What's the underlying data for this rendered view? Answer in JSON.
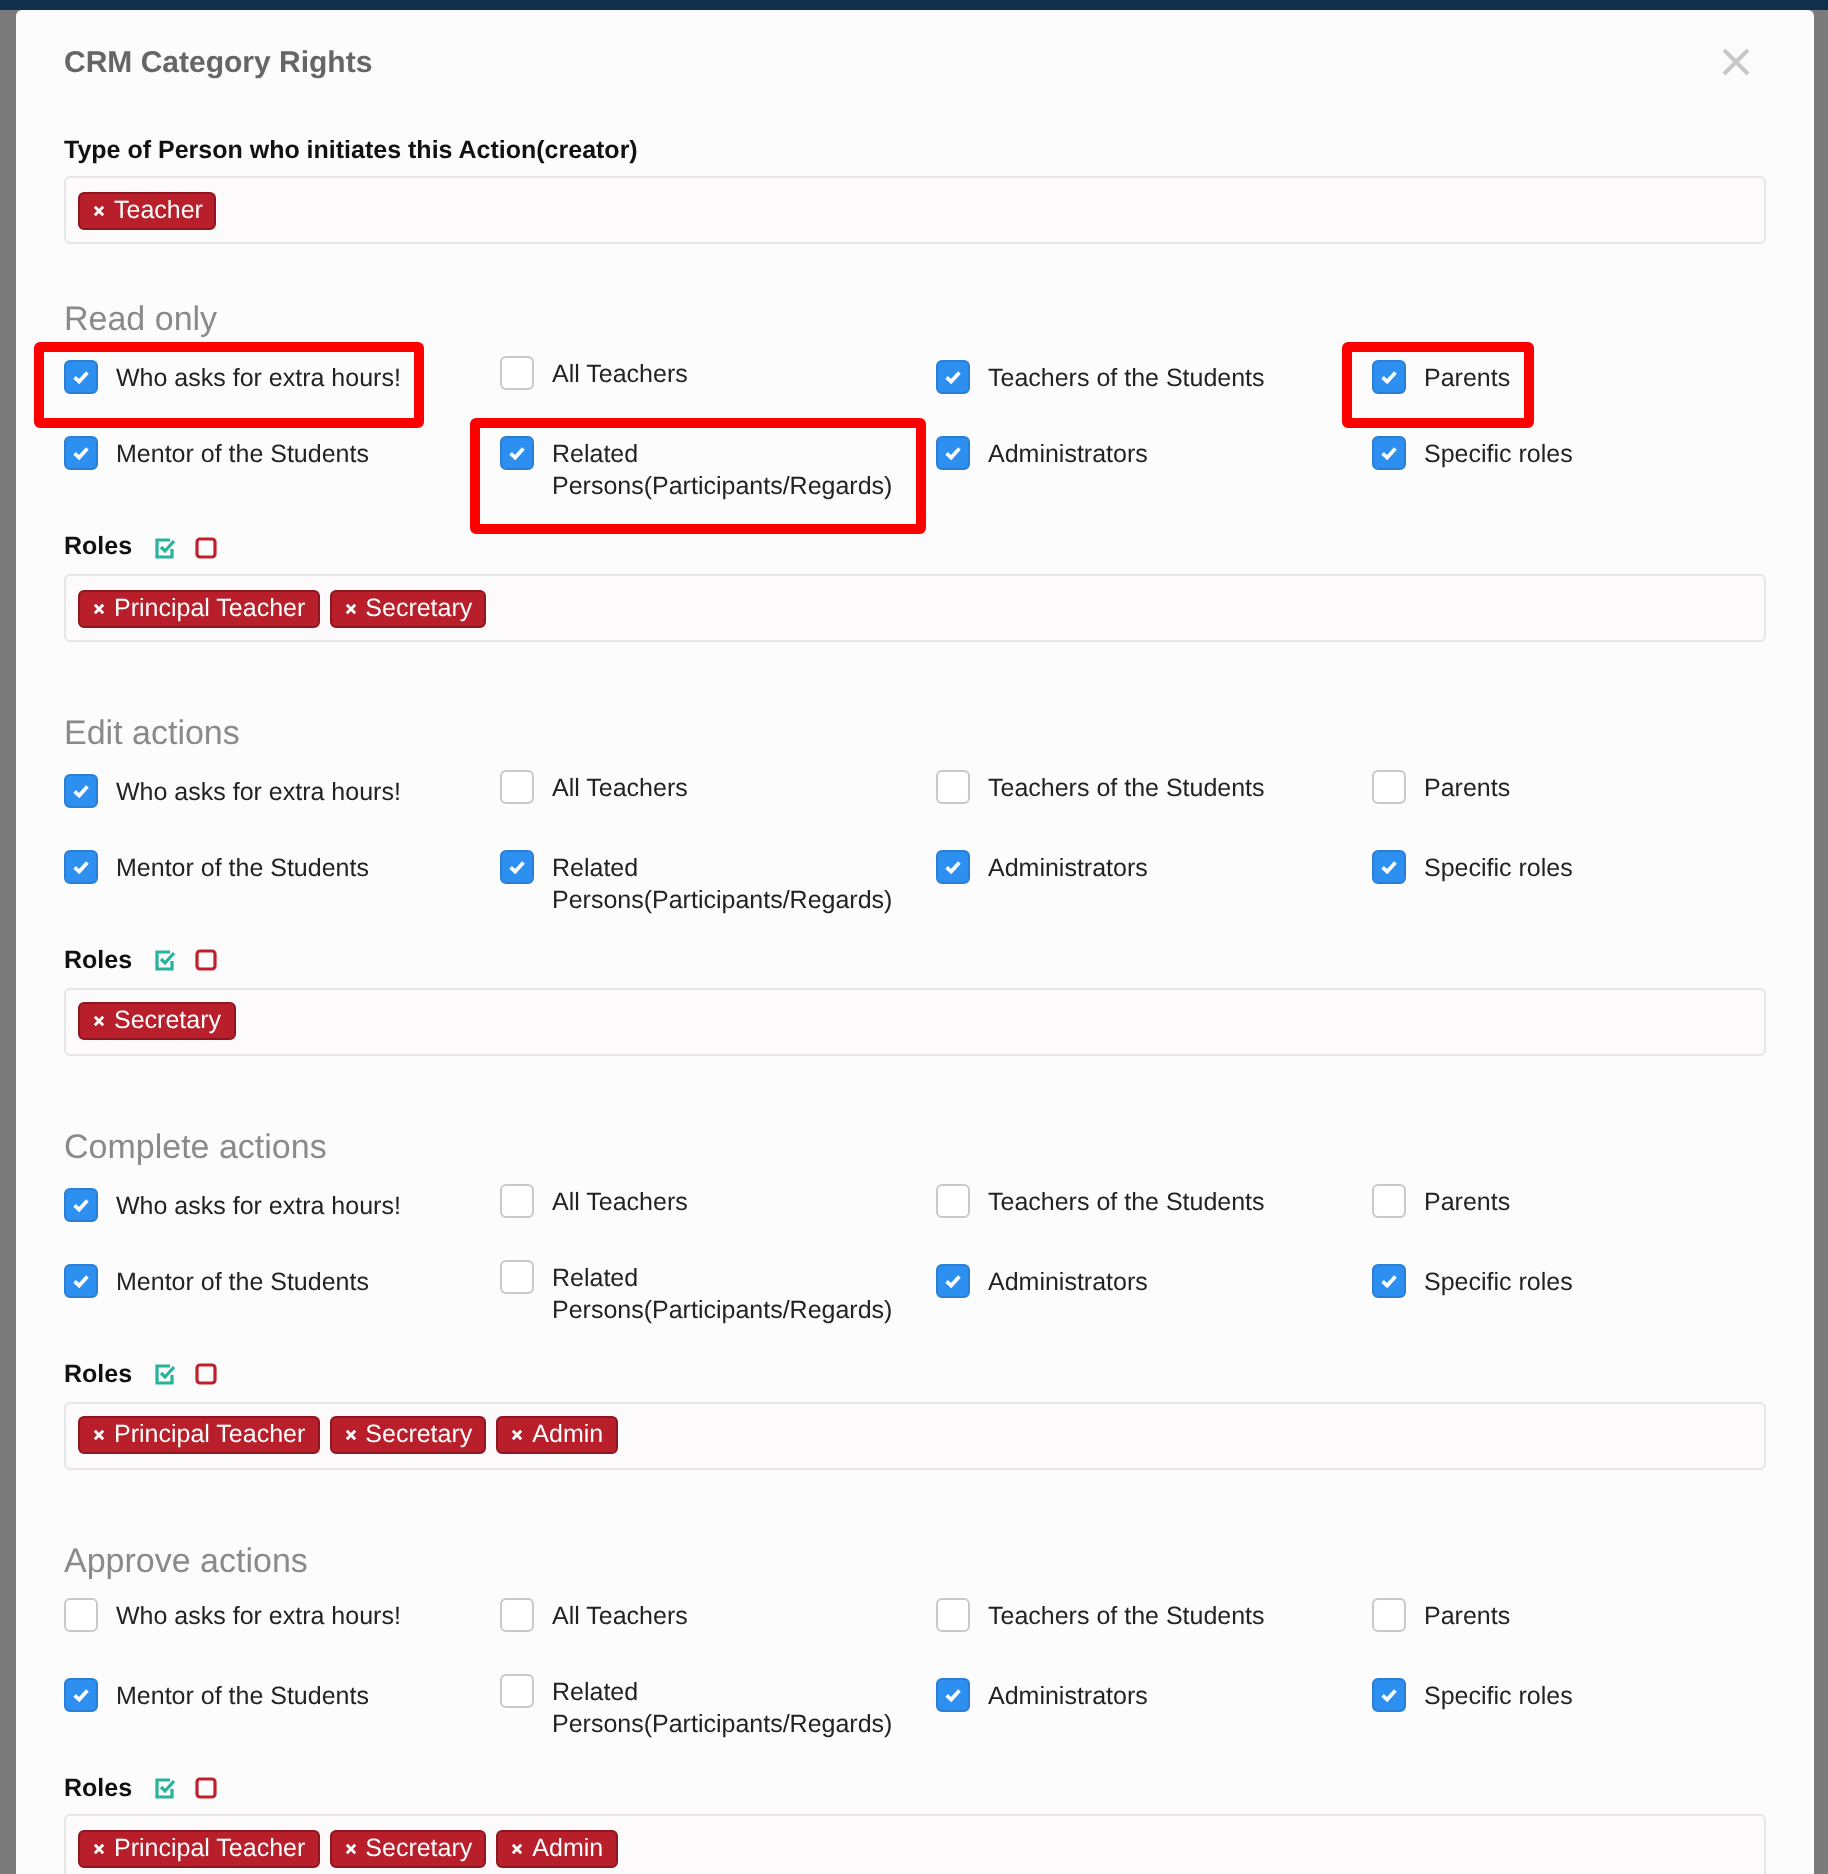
{
  "dialog": {
    "title": "CRM Category Rights"
  },
  "creator": {
    "label": "Type of Person who initiates this Action(creator)",
    "tags": [
      {
        "label": "Teacher"
      }
    ]
  },
  "sections": [
    {
      "title": "Read only",
      "options": [
        {
          "label": "Who asks for extra hours!",
          "checked": true,
          "highlighted": true
        },
        {
          "label": "All Teachers",
          "checked": false,
          "highlighted": false
        },
        {
          "label": "Teachers of the Students",
          "checked": true,
          "highlighted": false
        },
        {
          "label": "Parents",
          "checked": true,
          "highlighted": true
        },
        {
          "label": "Mentor of the Students",
          "checked": true,
          "highlighted": false
        },
        {
          "label": "Related Persons(Participants/Regards)",
          "checked": true,
          "highlighted": true
        },
        {
          "label": "Administrators",
          "checked": true,
          "highlighted": false
        },
        {
          "label": "Specific roles",
          "checked": true,
          "highlighted": false
        }
      ],
      "roles": {
        "label": "Roles",
        "tags": [
          {
            "label": "Principal Teacher"
          },
          {
            "label": "Secretary"
          }
        ]
      }
    },
    {
      "title": "Edit actions",
      "options": [
        {
          "label": "Who asks for extra hours!",
          "checked": true,
          "highlighted": false
        },
        {
          "label": "All Teachers",
          "checked": false,
          "highlighted": false
        },
        {
          "label": "Teachers of the Students",
          "checked": false,
          "highlighted": false
        },
        {
          "label": "Parents",
          "checked": false,
          "highlighted": false
        },
        {
          "label": "Mentor of the Students",
          "checked": true,
          "highlighted": false
        },
        {
          "label": "Related Persons(Participants/Regards)",
          "checked": true,
          "highlighted": false
        },
        {
          "label": "Administrators",
          "checked": true,
          "highlighted": false
        },
        {
          "label": "Specific roles",
          "checked": true,
          "highlighted": false
        }
      ],
      "roles": {
        "label": "Roles",
        "tags": [
          {
            "label": "Secretary"
          }
        ]
      }
    },
    {
      "title": "Complete actions",
      "options": [
        {
          "label": "Who asks for extra hours!",
          "checked": true,
          "highlighted": false
        },
        {
          "label": "All Teachers",
          "checked": false,
          "highlighted": false
        },
        {
          "label": "Teachers of the Students",
          "checked": false,
          "highlighted": false
        },
        {
          "label": "Parents",
          "checked": false,
          "highlighted": false
        },
        {
          "label": "Mentor of the Students",
          "checked": true,
          "highlighted": false
        },
        {
          "label": "Related Persons(Participants/Regards)",
          "checked": false,
          "highlighted": false
        },
        {
          "label": "Administrators",
          "checked": true,
          "highlighted": false
        },
        {
          "label": "Specific roles",
          "checked": true,
          "highlighted": false
        }
      ],
      "roles": {
        "label": "Roles",
        "tags": [
          {
            "label": "Principal Teacher"
          },
          {
            "label": "Secretary"
          },
          {
            "label": "Admin"
          }
        ]
      }
    },
    {
      "title": "Approve actions",
      "options": [
        {
          "label": "Who asks for extra hours!",
          "checked": false,
          "highlighted": false
        },
        {
          "label": "All Teachers",
          "checked": false,
          "highlighted": false
        },
        {
          "label": "Teachers of the Students",
          "checked": false,
          "highlighted": false
        },
        {
          "label": "Parents",
          "checked": false,
          "highlighted": false
        },
        {
          "label": "Mentor of the Students",
          "checked": true,
          "highlighted": false
        },
        {
          "label": "Related Persons(Participants/Regards)",
          "checked": false,
          "highlighted": false
        },
        {
          "label": "Administrators",
          "checked": true,
          "highlighted": false
        },
        {
          "label": "Specific roles",
          "checked": true,
          "highlighted": false
        }
      ],
      "roles": {
        "label": "Roles",
        "tags": [
          {
            "label": "Principal Teacher"
          },
          {
            "label": "Secretary"
          },
          {
            "label": "Admin"
          }
        ]
      }
    }
  ]
}
